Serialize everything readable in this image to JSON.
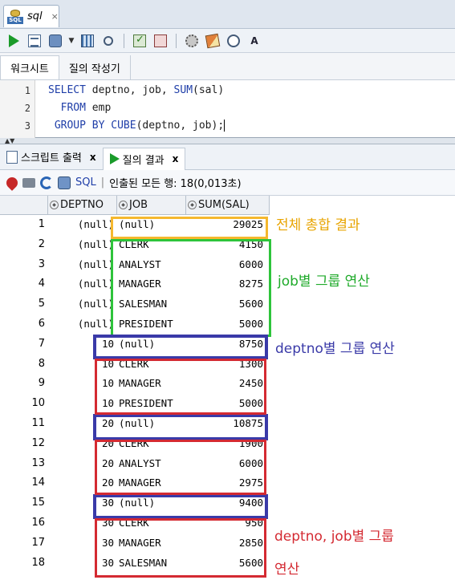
{
  "title_tab": {
    "title": "sql",
    "close": "×"
  },
  "worksheet_tabs": [
    "워크시트",
    "질의 작성기"
  ],
  "editor": {
    "lines": [
      {
        "num": "1",
        "text_html": "<span class=\"kw\">SELECT</span> deptno, job, <span class=\"kw\">SUM</span>(sal)"
      },
      {
        "num": "2",
        "text_html": "  <span class=\"kw\">FROM</span> emp"
      },
      {
        "num": "3",
        "text_html": " <span class=\"kw\">GROUP BY</span> <span class=\"kw\">CUBE</span>(deptno, job);"
      }
    ]
  },
  "output_tabs": [
    {
      "label": "스크립트 출력",
      "close": "x"
    },
    {
      "label": "질의 결과",
      "close": "x"
    }
  ],
  "results_toolbar": {
    "sql_label": "SQL",
    "divider": "|",
    "status": "인출된 모든 행: 18(0,013초)"
  },
  "columns": [
    "DEPTNO",
    "JOB",
    "SUM(SAL)"
  ],
  "rows": [
    {
      "n": "1",
      "deptno": "(null)",
      "job": "(null)",
      "sal": "29025"
    },
    {
      "n": "2",
      "deptno": "(null)",
      "job": "CLERK",
      "sal": "4150"
    },
    {
      "n": "3",
      "deptno": "(null)",
      "job": "ANALYST",
      "sal": "6000"
    },
    {
      "n": "4",
      "deptno": "(null)",
      "job": "MANAGER",
      "sal": "8275"
    },
    {
      "n": "5",
      "deptno": "(null)",
      "job": "SALESMAN",
      "sal": "5600"
    },
    {
      "n": "6",
      "deptno": "(null)",
      "job": "PRESIDENT",
      "sal": "5000"
    },
    {
      "n": "7",
      "deptno": "10",
      "job": "(null)",
      "sal": "8750"
    },
    {
      "n": "8",
      "deptno": "10",
      "job": "CLERK",
      "sal": "1300"
    },
    {
      "n": "9",
      "deptno": "10",
      "job": "MANAGER",
      "sal": "2450"
    },
    {
      "n": "10",
      "deptno": "10",
      "job": "PRESIDENT",
      "sal": "5000"
    },
    {
      "n": "11",
      "deptno": "20",
      "job": "(null)",
      "sal": "10875"
    },
    {
      "n": "12",
      "deptno": "20",
      "job": "CLERK",
      "sal": "1900"
    },
    {
      "n": "13",
      "deptno": "20",
      "job": "ANALYST",
      "sal": "6000"
    },
    {
      "n": "14",
      "deptno": "20",
      "job": "MANAGER",
      "sal": "2975"
    },
    {
      "n": "15",
      "deptno": "30",
      "job": "(null)",
      "sal": "9400"
    },
    {
      "n": "16",
      "deptno": "30",
      "job": "CLERK",
      "sal": "950"
    },
    {
      "n": "17",
      "deptno": "30",
      "job": "MANAGER",
      "sal": "2850"
    },
    {
      "n": "18",
      "deptno": "30",
      "job": "SALESMAN",
      "sal": "5600"
    }
  ],
  "annotations": {
    "total": "전체 총합 결과",
    "job_group": "job별 그룹 연산",
    "deptno_group": "deptno별 그룹 연산",
    "deptno_job_group_line1": "deptno, job별 그룹",
    "deptno_job_group_line2": "연산"
  },
  "colors": {
    "total_box": "#f5b82e",
    "job_box": "#2ec43b",
    "deptno_box": "#3a3aa8",
    "deptno_job_box": "#d42a32",
    "total_text": "#e8a400",
    "job_text": "#1faa2a",
    "deptno_text": "#3a3aa8",
    "deptno_job_text": "#d42a32"
  }
}
